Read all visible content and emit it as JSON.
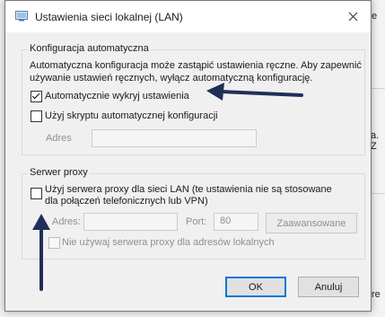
{
  "background": {
    "fragments": [
      "e",
      "a. Z",
      "re"
    ]
  },
  "dialog": {
    "title": "Ustawienia sieci lokalnej (LAN)",
    "auto_config": {
      "legend": "Konfiguracja automatyczna",
      "description_line1": "Automatyczna konfiguracja może zastąpić ustawienia ręczne. Aby zapewnić",
      "description_line2": "używanie ustawień ręcznych, wyłącz automatyczną konfigurację.",
      "auto_detect": {
        "label": "Automatycznie wykryj ustawienia",
        "checked": true
      },
      "use_script": {
        "label": "Użyj skryptu automatycznej konfiguracji",
        "checked": false
      },
      "address_label": "Adres",
      "address_value": ""
    },
    "proxy": {
      "legend": "Serwer proxy",
      "use_proxy": {
        "label_line1": "Użyj serwera proxy dla sieci LAN (te ustawienia nie są stosowane",
        "label_line2": "dla połączeń telefonicznych lub VPN)",
        "checked": false
      },
      "address_label": "Adres:",
      "port_label": "Port:",
      "port_value": "80",
      "advanced_label": "Zaawansowane",
      "bypass_local": {
        "label": "Nie używaj serwera proxy dla adresów lokalnych",
        "checked": false
      }
    },
    "ok_label": "OK",
    "cancel_label": "Anuluj"
  },
  "colors": {
    "arrow": "#1f2f57",
    "accent": "#0078d7"
  }
}
